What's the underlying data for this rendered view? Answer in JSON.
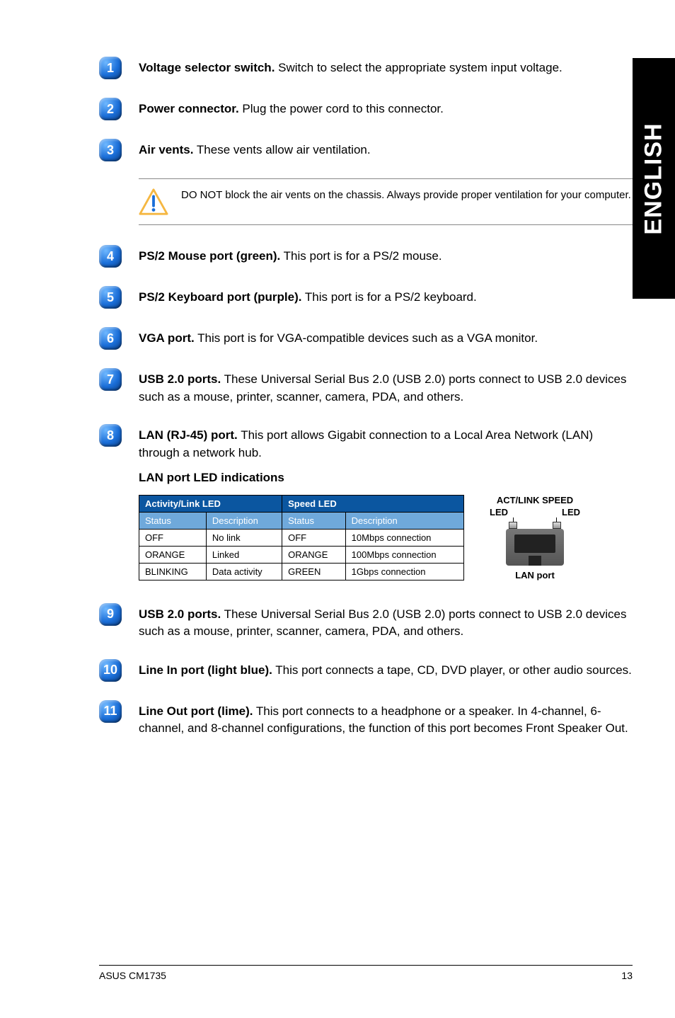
{
  "sideTab": "ENGLISH",
  "items": [
    {
      "num": "1",
      "title": "Voltage selector switch.",
      "desc": " Switch to select the appropriate system input voltage."
    },
    {
      "num": "2",
      "title": "Power connector.",
      "desc": " Plug the power cord to this connector."
    },
    {
      "num": "3",
      "title": "Air vents.",
      "desc": " These vents allow air ventilation."
    }
  ],
  "caution": "DO NOT block the air vents on the chassis. Always provide proper ventilation for your computer.",
  "items2": [
    {
      "num": "4",
      "title": "PS/2 Mouse port (green).",
      "desc": " This port is for a PS/2 mouse."
    },
    {
      "num": "5",
      "title": "PS/2 Keyboard port (purple).",
      "desc": " This port is for a PS/2 keyboard."
    },
    {
      "num": "6",
      "title": "VGA port.",
      "desc": " This port is for VGA-compatible devices such as a VGA monitor."
    },
    {
      "num": "7",
      "title": "USB 2.0 ports.",
      "desc": " These Universal Serial Bus 2.0 (USB 2.0) ports connect to USB 2.0 devices such as a mouse, printer, scanner, camera, PDA, and others."
    },
    {
      "num": "8",
      "title": "LAN (RJ-45) port.",
      "desc": " This port allows Gigabit connection to a Local Area Network (LAN) through a network hub."
    }
  ],
  "lanHeading": "LAN port LED indications",
  "table": {
    "groupHeaders": [
      "Activity/Link LED",
      "Speed LED"
    ],
    "subHeaders": [
      "Status",
      "Description",
      "Status",
      "Description"
    ],
    "rows": [
      [
        "OFF",
        "No link",
        "OFF",
        "10Mbps connection"
      ],
      [
        "ORANGE",
        "Linked",
        "ORANGE",
        "100Mbps connection"
      ],
      [
        "BLINKING",
        "Data activity",
        "GREEN",
        "1Gbps connection"
      ]
    ]
  },
  "portFig": {
    "top": "ACT/LINK  SPEED",
    "ledLeft": "LED",
    "ledRight": "LED",
    "caption": "LAN port"
  },
  "items3": [
    {
      "num": "9",
      "title": "USB 2.0 ports.",
      "desc": " These Universal Serial Bus 2.0 (USB 2.0) ports connect to USB 2.0 devices such as a mouse, printer, scanner, camera, PDA, and others."
    },
    {
      "num": "10",
      "title": "Line In port (light blue).",
      "desc": " This port connects a tape, CD, DVD player, or other audio sources."
    },
    {
      "num": "11",
      "title": "Line Out port (lime).",
      "desc": " This port connects to a headphone or a speaker. In 4-channel, 6-channel, and 8-channel configurations, the function of this port becomes Front Speaker Out."
    }
  ],
  "footer": {
    "left": "ASUS CM1735",
    "right": "13"
  }
}
